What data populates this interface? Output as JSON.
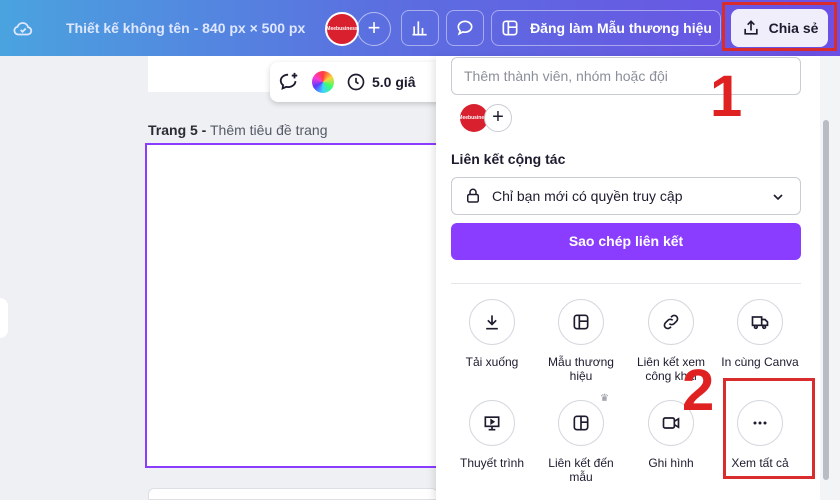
{
  "header": {
    "title": "Thiết kế không tên - 840 px × 500 px",
    "avatar_text": "Meebusiness",
    "brand_button": "Đăng làm Mẫu thương hiệu",
    "share_button": "Chia sẻ"
  },
  "toolbar": {
    "timer": "5.0 giâ"
  },
  "canvas": {
    "page_number": "Trang 5 -",
    "page_title_placeholder": " Thêm tiêu đề trang"
  },
  "share_panel": {
    "member_placeholder": "Thêm thành viên, nhóm hoặc đội",
    "collab_label": "Liên kết cộng tác",
    "access_value": "Chỉ bạn mới có quyền truy cập",
    "copy_link": "Sao chép liên kết",
    "options": [
      {
        "label": "Tải xuống",
        "icon": "download-icon"
      },
      {
        "label": "Mẫu thương hiệu",
        "icon": "template-icon"
      },
      {
        "label": "Liên kết xem công khai",
        "icon": "link-icon"
      },
      {
        "label": "In cùng Canva",
        "icon": "truck-icon"
      },
      {
        "label": "Thuyết trình",
        "icon": "presentation-icon"
      },
      {
        "label": "Liên kết đến mẫu",
        "icon": "template-link-icon"
      },
      {
        "label": "Ghi hình",
        "icon": "video-icon"
      },
      {
        "label": "Xem tất cả",
        "icon": "more-icon"
      }
    ]
  },
  "annotations": {
    "step1": "1",
    "step2": "2"
  },
  "colors": {
    "accent": "#8b3dff",
    "highlight": "#d92d2d"
  }
}
